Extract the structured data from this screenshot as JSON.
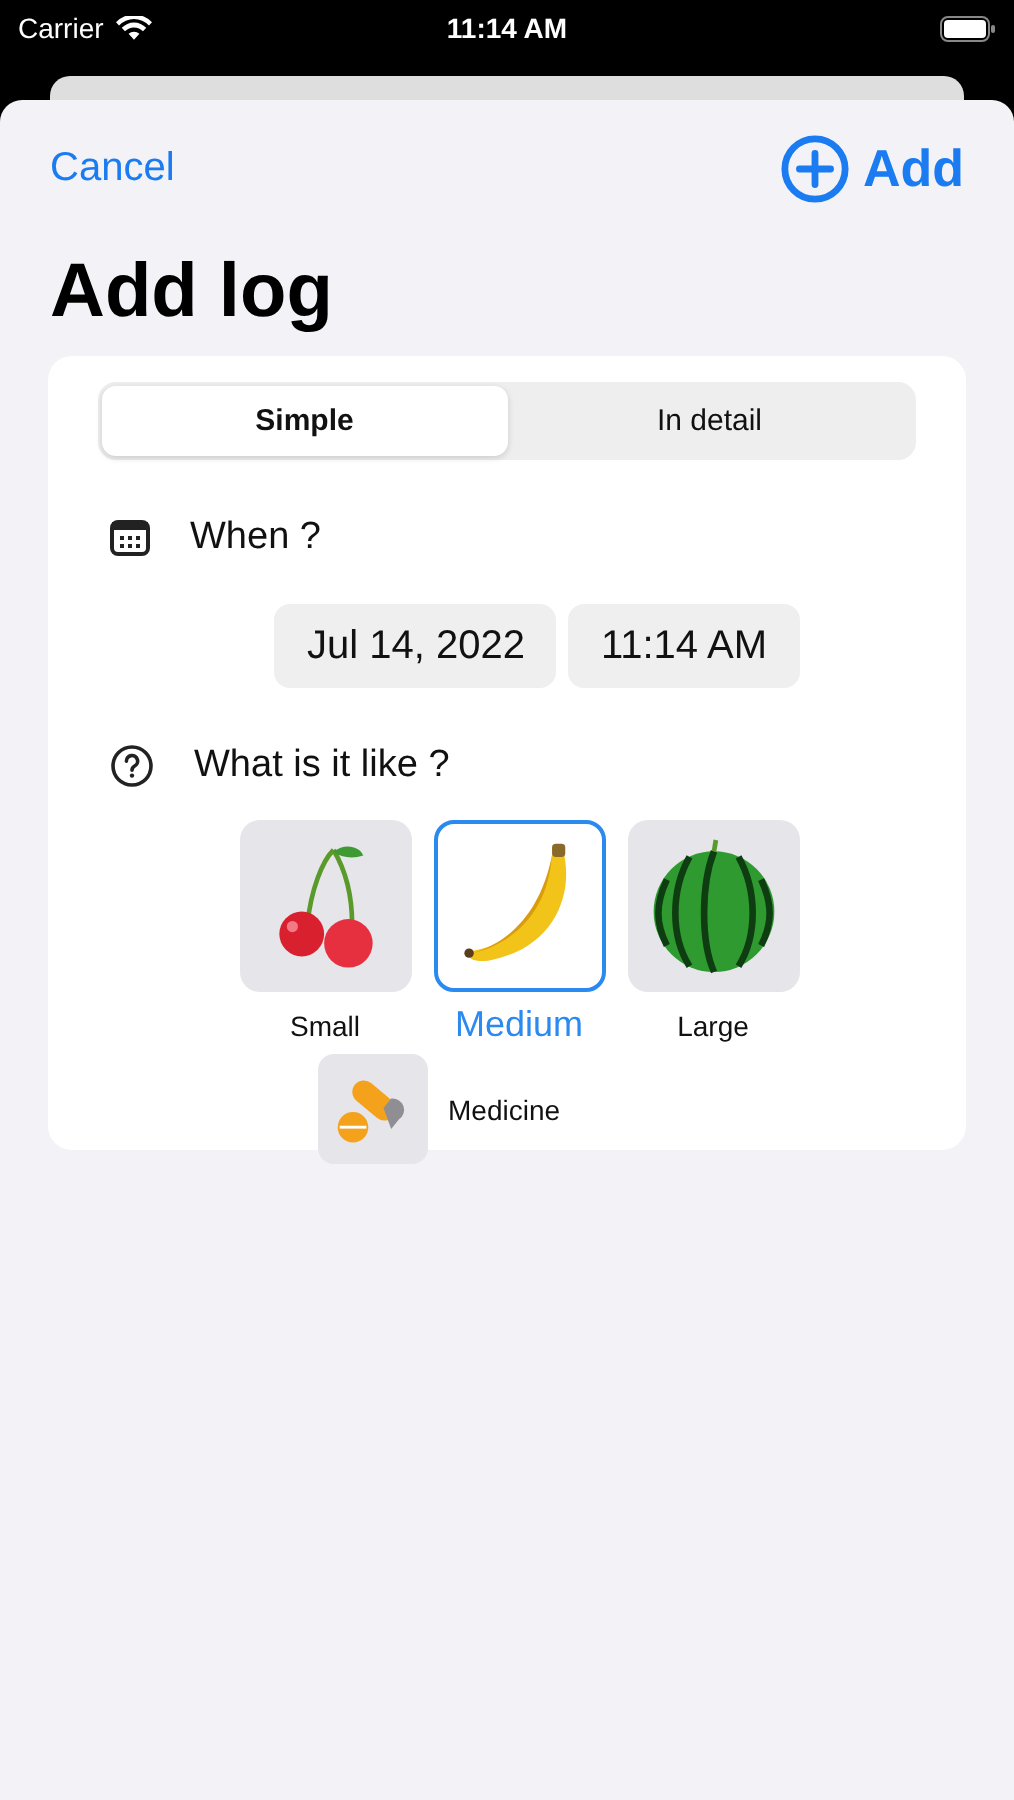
{
  "status_bar": {
    "carrier": "Carrier",
    "time": "11:14 AM"
  },
  "nav": {
    "cancel": "Cancel",
    "add": "Add"
  },
  "title": "Add log",
  "segments": [
    {
      "label": "Simple",
      "selected": true
    },
    {
      "label": "In detail",
      "selected": false
    }
  ],
  "when": {
    "label": "When ?",
    "date": "Jul 14, 2022",
    "time": "11:14 AM"
  },
  "what": {
    "label": "What is it like ?",
    "sizes": [
      {
        "label": "Small",
        "kind": "cherry",
        "selected": false
      },
      {
        "label": "Medium",
        "kind": "banana",
        "selected": true
      },
      {
        "label": "Large",
        "kind": "watermelon",
        "selected": false
      }
    ],
    "medicine": {
      "label": "Medicine",
      "selected": false
    }
  }
}
